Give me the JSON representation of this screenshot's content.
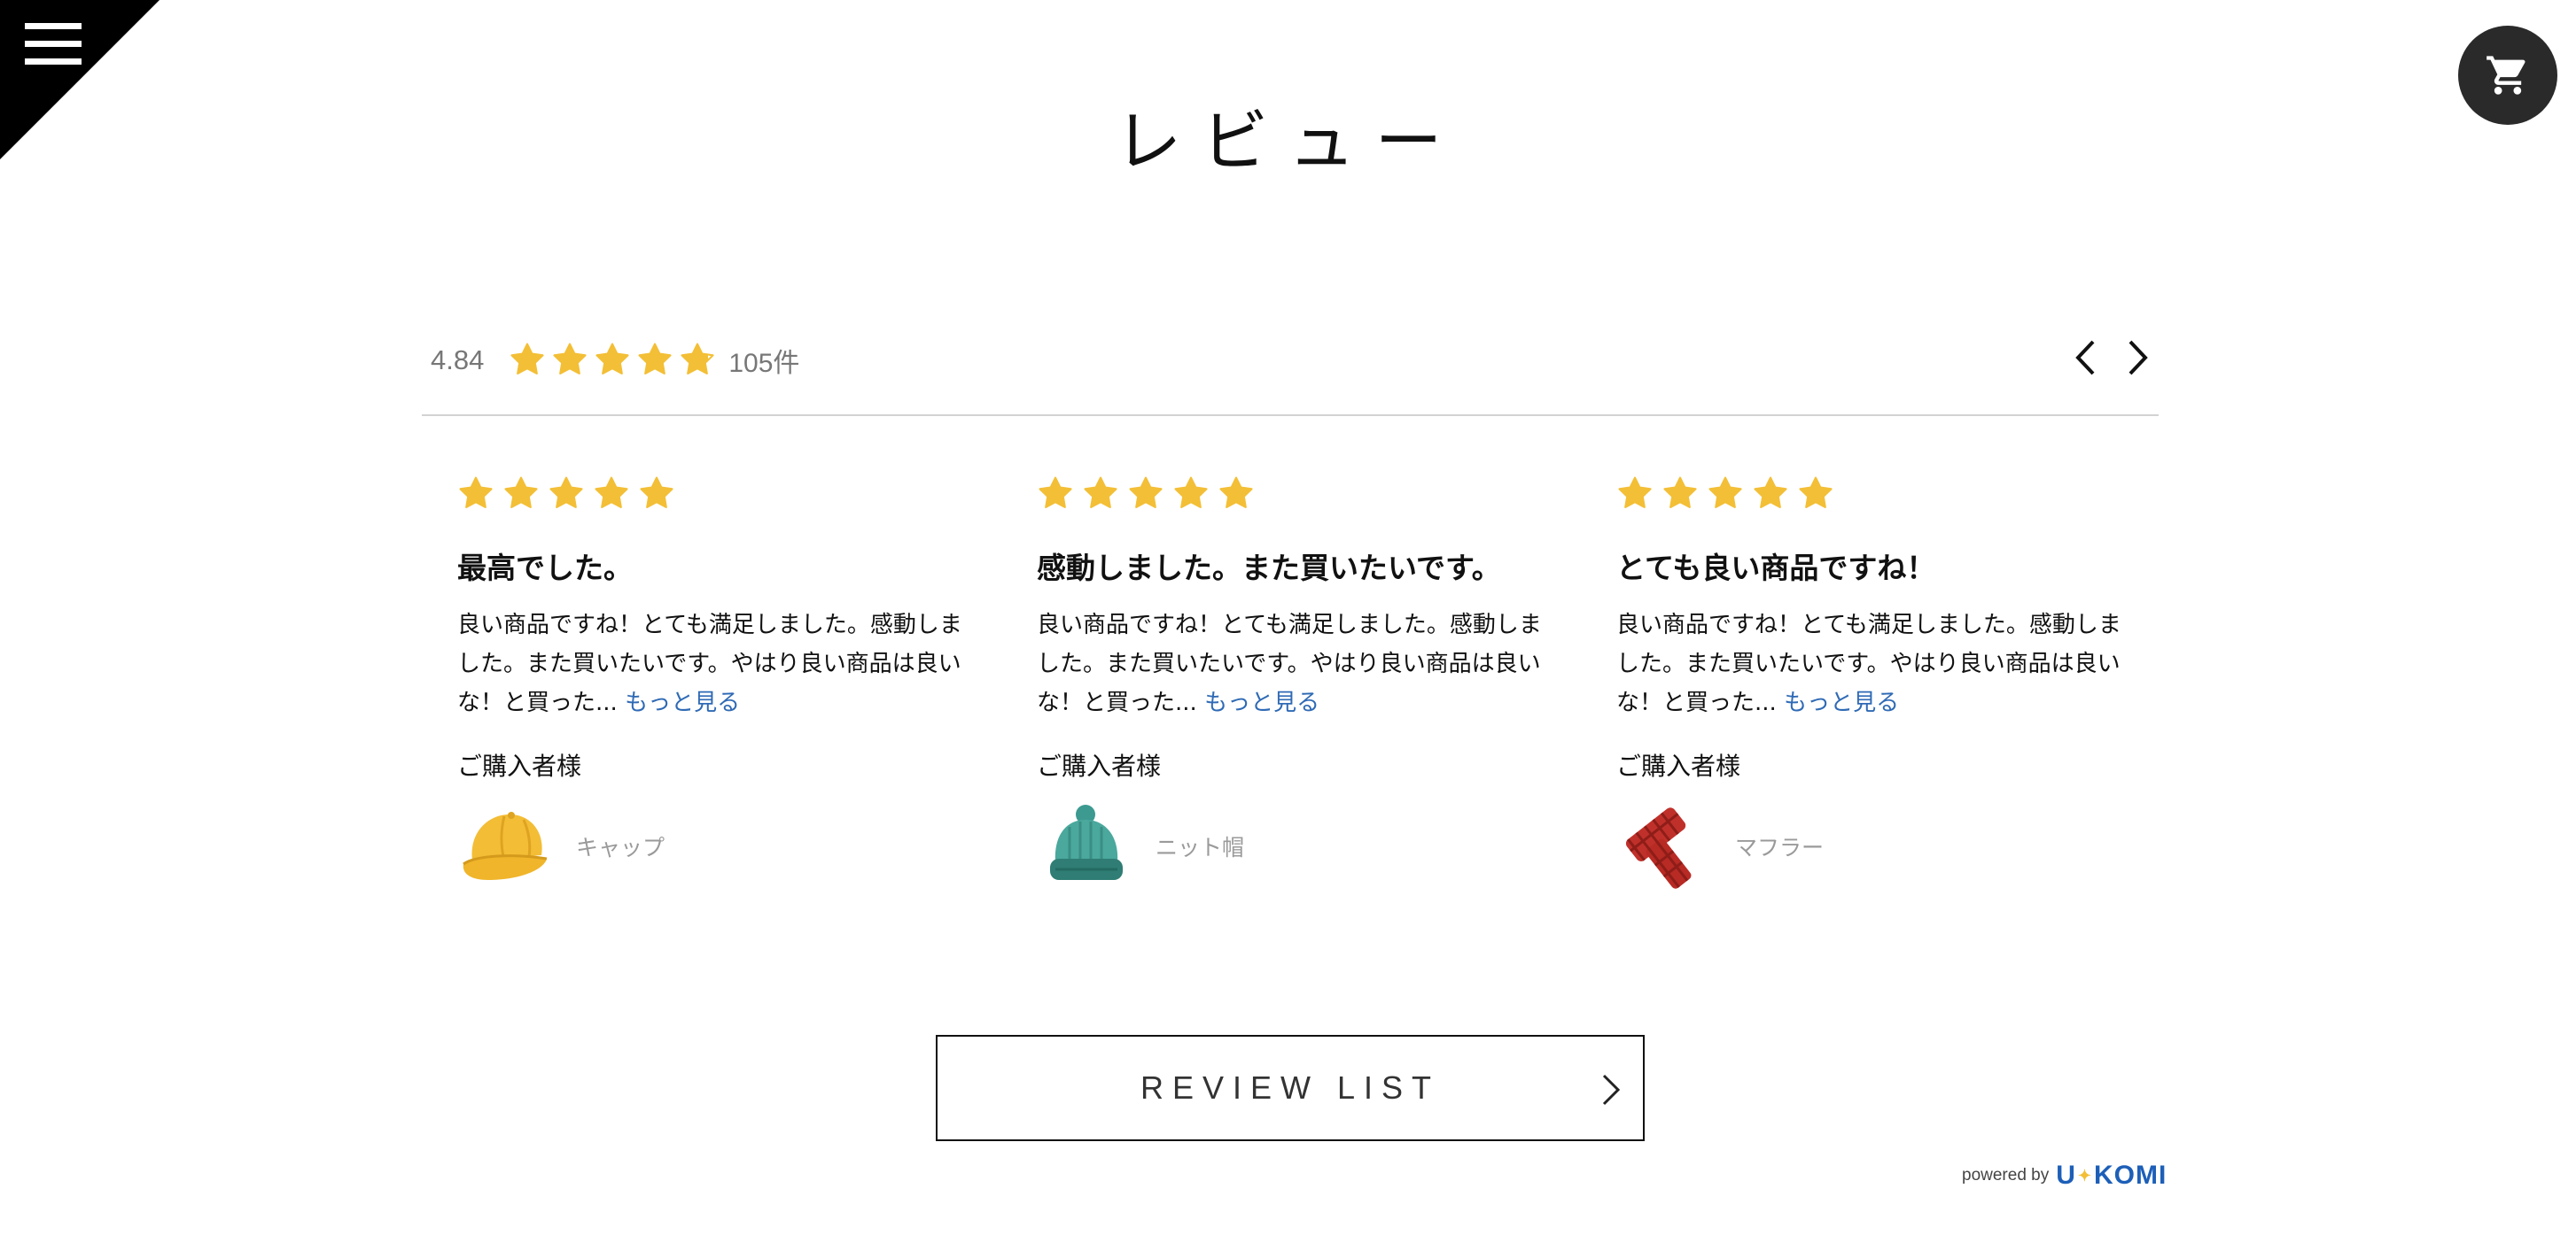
{
  "header": {
    "title": "レビュー",
    "menu_icon": "hamburger-menu-icon",
    "cart_icon": "shopping-cart-icon"
  },
  "summary": {
    "score": "4.84",
    "rating": 4.84,
    "max_rating": 5,
    "count": "105件"
  },
  "colors": {
    "star": "#f3bf36",
    "link": "#2f6ab5",
    "brand": "#1d5fb8"
  },
  "reviews": [
    {
      "rating": 5,
      "title": "最高でした。",
      "body": "良い商品ですね！とても満足しました。感動しました。また買いたいです。やはり良い商品は良いな！と買った...",
      "more": "もっと見る",
      "buyer": "ご購入者様",
      "product": "キャップ",
      "product_icon": "yellow-cap-icon"
    },
    {
      "rating": 5,
      "title": "感動しました。また買いたいです。",
      "body": "良い商品ですね！とても満足しました。感動しました。また買いたいです。やはり良い商品は良いな！と買った...",
      "more": "もっと見る",
      "buyer": "ご購入者様",
      "product": "ニット帽",
      "product_icon": "teal-knit-hat-icon"
    },
    {
      "rating": 5,
      "title": "とても良い商品ですね！",
      "body": "良い商品ですね！とても満足しました。感動しました。また買いたいです。やはり良い商品は良いな！と買った...",
      "more": "もっと見る",
      "buyer": "ご購入者様",
      "product": "マフラー",
      "product_icon": "red-scarf-icon"
    }
  ],
  "review_list_button": "REVIEW LIST",
  "footer": {
    "powered_by": "powered by",
    "logo_left": "U",
    "logo_right": "KOMI"
  }
}
